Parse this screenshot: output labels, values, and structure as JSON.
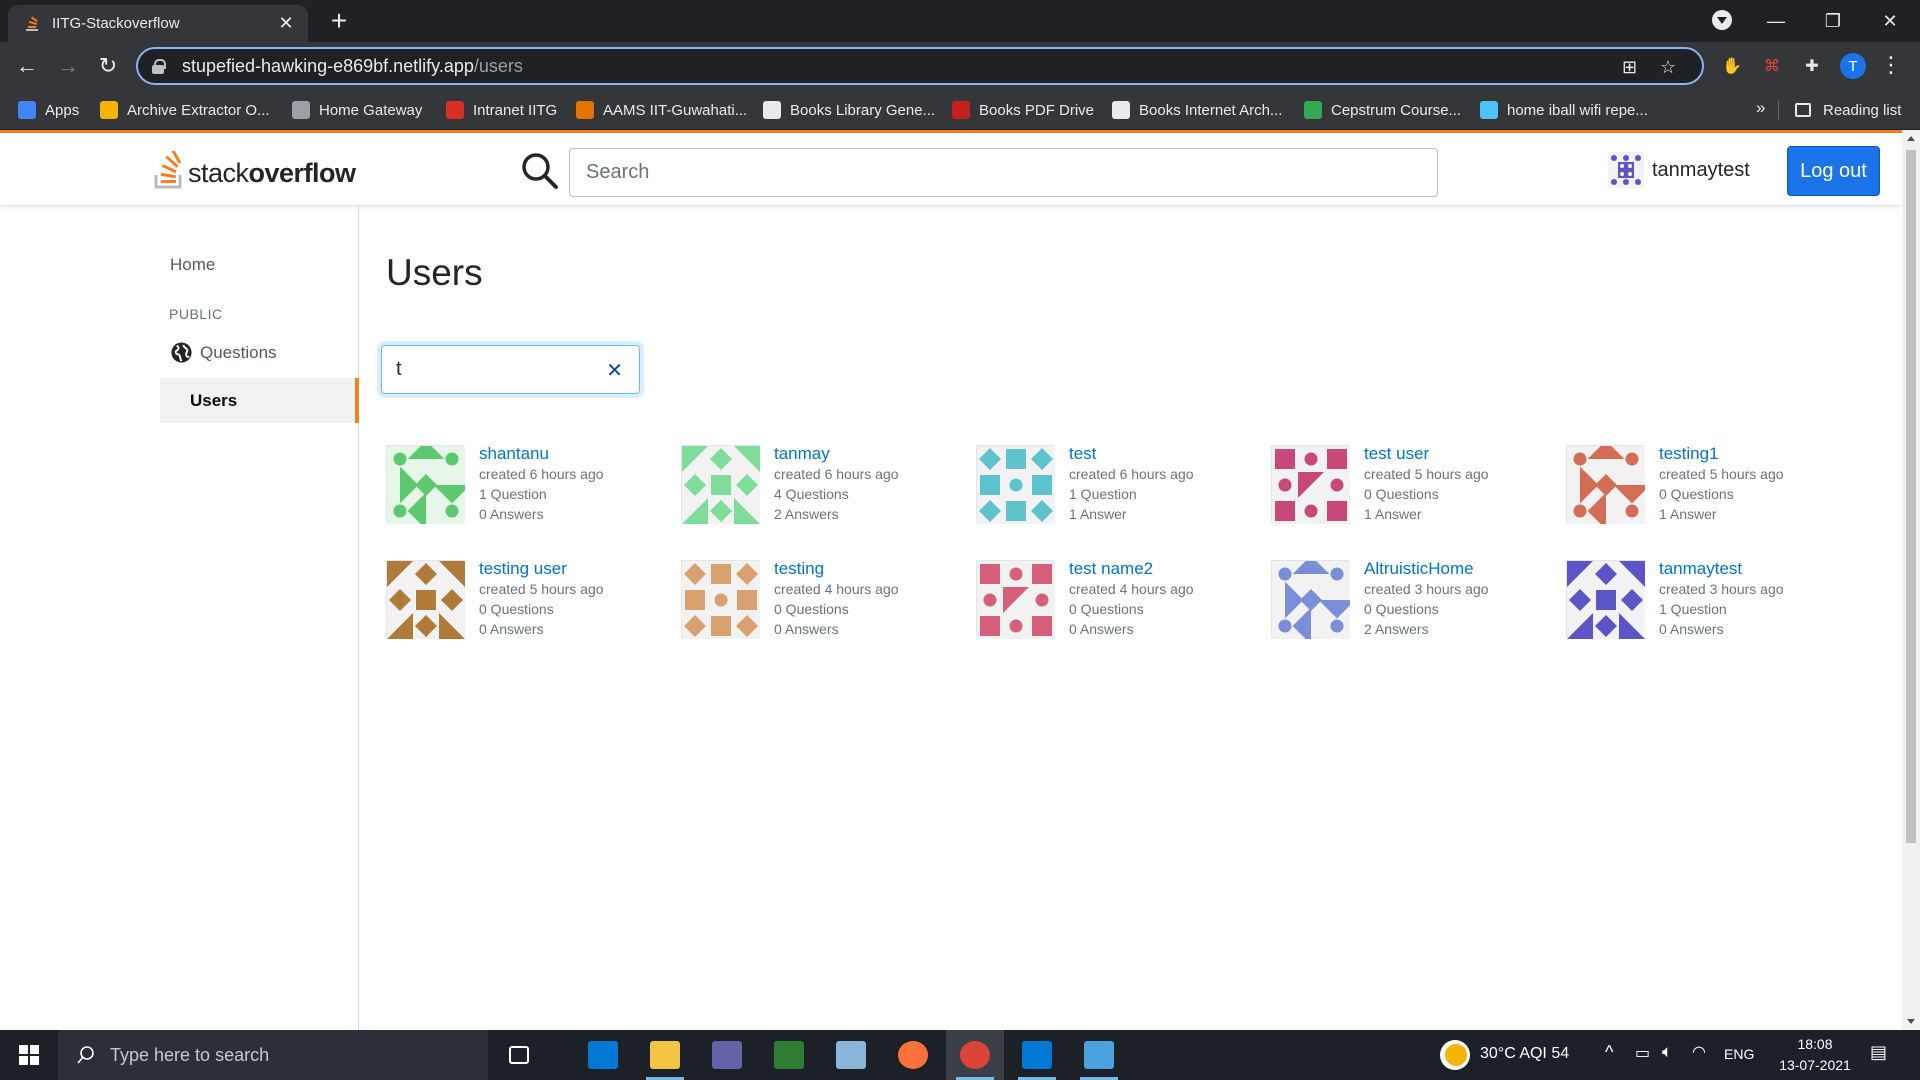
{
  "browser": {
    "tab_title": "IITG-Stackoverflow",
    "tab_close": "✕",
    "new_tab": "+",
    "url_host": "stupefied-hawking-e869bf.netlify.app",
    "url_path": "/users",
    "profile_initial": "T",
    "bookmarks": [
      {
        "label": "Apps",
        "color": "#4285f4"
      },
      {
        "label": "Archive Extractor O...",
        "color": "#f4b400"
      },
      {
        "label": "Home Gateway",
        "color": "#9aa0a6"
      },
      {
        "label": "Intranet IITG",
        "color": "#d93025"
      },
      {
        "label": "AAMS IIT-Guwahati...",
        "color": "#e37400"
      },
      {
        "label": "Books Library Gene...",
        "color": "#e8eaed"
      },
      {
        "label": "Books PDF Drive",
        "color": "#c5221f"
      },
      {
        "label": "Books Internet Arch...",
        "color": "#e8eaed"
      },
      {
        "label": "Cepstrum Course...",
        "color": "#34a853"
      },
      {
        "label": "home iball wifi repe...",
        "color": "#4fc3f7"
      }
    ],
    "bookmarks_more": "»",
    "reading_list": "Reading list"
  },
  "header": {
    "logo_light": "stack",
    "logo_bold": "overflow",
    "search_placeholder": "Search",
    "username": "tanmaytest",
    "logout_label": "Log out"
  },
  "sidebar": {
    "home": "Home",
    "public": "PUBLIC",
    "questions": "Questions",
    "users": "Users"
  },
  "main": {
    "title": "Users",
    "filter_value": "t",
    "filter_clear": "✕"
  },
  "users": [
    {
      "name": "shantanu",
      "created": "created 6 hours ago",
      "questions": "1 Question",
      "answers": "0 Answers",
      "color": "#5cc96f",
      "bg": "#e6f6e8"
    },
    {
      "name": "tanmay",
      "created": "created 6 hours ago",
      "questions": "4 Questions",
      "answers": "2 Answers",
      "color": "#7fdc9a",
      "bg": "#f2f2f2"
    },
    {
      "name": "test",
      "created": "created 6 hours ago",
      "questions": "1 Question",
      "answers": "1 Answer",
      "color": "#5ec3cc",
      "bg": "#f2f2f2"
    },
    {
      "name": "test user",
      "created": "created 5 hours ago",
      "questions": "0 Questions",
      "answers": "1 Answer",
      "color": "#c8487a",
      "bg": "#f2f2f2"
    },
    {
      "name": "testing1",
      "created": "created 5 hours ago",
      "questions": "0 Questions",
      "answers": "1 Answer",
      "color": "#d46d56",
      "bg": "#f2f2f2"
    },
    {
      "name": "testing user",
      "created": "created 5 hours ago",
      "questions": "0 Questions",
      "answers": "0 Answers",
      "color": "#b07a3a",
      "bg": "#f2f2f2"
    },
    {
      "name": "testing",
      "created": "created 4 hours ago",
      "questions": "0 Questions",
      "answers": "0 Answers",
      "color": "#d9a070",
      "bg": "#f2f2f2"
    },
    {
      "name": "test name2",
      "created": "created 4 hours ago",
      "questions": "0 Questions",
      "answers": "0 Answers",
      "color": "#d6607a",
      "bg": "#f2f2f2"
    },
    {
      "name": "AltruisticHome",
      "created": "created 3 hours ago",
      "questions": "0 Questions",
      "answers": "2 Answers",
      "color": "#7b8fd8",
      "bg": "#f2f2f2"
    },
    {
      "name": "tanmaytest",
      "created": "created 3 hours ago",
      "questions": "1 Question",
      "answers": "0 Answers",
      "color": "#5c55c8",
      "bg": "#f2f2f2"
    }
  ],
  "taskbar": {
    "search_placeholder": "Type here to search",
    "weather": "30°C  AQI 54",
    "language": "ENG",
    "time": "18:08",
    "date": "13-07-2021",
    "apps": [
      {
        "name": "task-view",
        "color": "#ffffff"
      },
      {
        "name": "store",
        "color": "#0078d4"
      },
      {
        "name": "file-explorer",
        "color": "#f4c542"
      },
      {
        "name": "teams",
        "color": "#6264a7"
      },
      {
        "name": "app-red-green",
        "color": "#2e7d32"
      },
      {
        "name": "app-folder-blue",
        "color": "#8ab4d8"
      },
      {
        "name": "firefox",
        "color": "#ff7139"
      },
      {
        "name": "chrome",
        "color": "#db4437"
      },
      {
        "name": "vscode",
        "color": "#0078d4"
      },
      {
        "name": "photos",
        "color": "#4aa3df"
      }
    ]
  }
}
